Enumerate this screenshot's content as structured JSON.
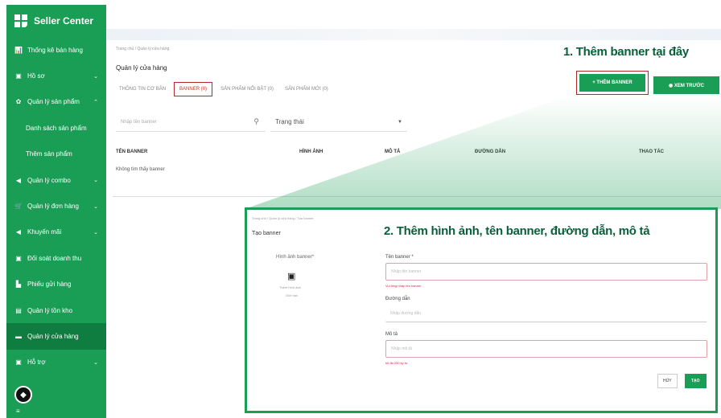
{
  "sidebar": {
    "brand": "Seller Center",
    "items": [
      {
        "label": "Thống kê bán hàng",
        "icon": "chart-icon",
        "glyph": "📊"
      },
      {
        "label": "Hồ sơ",
        "icon": "profile-icon",
        "glyph": "▣"
      },
      {
        "label": "Quản lý sản phẩm",
        "icon": "products-icon",
        "glyph": "✿"
      },
      {
        "label": "Danh sách sản phẩm"
      },
      {
        "label": "Thêm sản phẩm"
      },
      {
        "label": "Quản lý combo",
        "icon": "combo-icon",
        "glyph": "◀"
      },
      {
        "label": "Quản lý đơn hàng",
        "icon": "cart-icon",
        "glyph": "🛒"
      },
      {
        "label": "Khuyến mãi",
        "icon": "promo-icon",
        "glyph": "◀"
      },
      {
        "label": "Đối soát doanh thu",
        "icon": "revenue-icon",
        "glyph": "▣"
      },
      {
        "label": "Phiếu gửi hàng",
        "icon": "shipping-icon",
        "glyph": "▙"
      },
      {
        "label": "Quản lý tồn kho",
        "icon": "inventory-icon",
        "glyph": "▤"
      },
      {
        "label": "Quản lý cửa hàng",
        "icon": "store-icon",
        "glyph": "▬"
      },
      {
        "label": "Hỗ trợ",
        "icon": "support-icon",
        "glyph": "▣"
      }
    ],
    "chat_glyph": "◆",
    "bottom_glyph": "≡"
  },
  "main": {
    "breadcrumb": "Trang chủ / Quản lý cửa hàng",
    "title": "Quản lý cửa hàng",
    "step1": "1. Thêm banner tại đây",
    "tabs": [
      "THÔNG TIN CƠ BẢN",
      "BANNER (0)",
      "SẢN PHẨM NỔI BẬT (0)",
      "SẢN PHẨM MỚI (0)"
    ],
    "add_button": "+ THÊM BANNER",
    "preview_button": "◉ XEM TRƯỚC",
    "search_placeholder": "Nhập tên banner",
    "search_icon": "search-icon",
    "status_label": "Trạng thái",
    "columns": [
      "TÊN BANNER",
      "HÌNH ẢNH",
      "MÔ TẢ",
      "ĐƯỜNG DẪN",
      "THAO TÁC"
    ],
    "empty": "Không tìm thấy banner"
  },
  "form": {
    "breadcrumb": "Trang chủ / Quản lý cửa hàng / Tạo banner",
    "title": "Tạo banner",
    "step2": "2. Thêm hình ảnh, tên banner, đường dẫn, mô tả",
    "upload_label": "Hình ảnh banner*",
    "upload_note1": "Thêm hình ảnh",
    "upload_note2": "Giới hạn",
    "name_label": "Tên banner *",
    "name_placeholder": "Nhập tên banner",
    "name_error": "Vui lòng nhập tên banner",
    "link_label": "Đường dẫn",
    "link_placeholder": "Nhập đường dẫn",
    "desc_label": "Mô tả",
    "desc_placeholder": "Nhập mô tả",
    "desc_note": "tối đa 250 ký tự",
    "cancel": "HỦY",
    "save": "TẠO"
  },
  "colors": {
    "green": "#1a9e55",
    "dark_green": "#0a5f3b",
    "highlight": "#b02a2a"
  }
}
